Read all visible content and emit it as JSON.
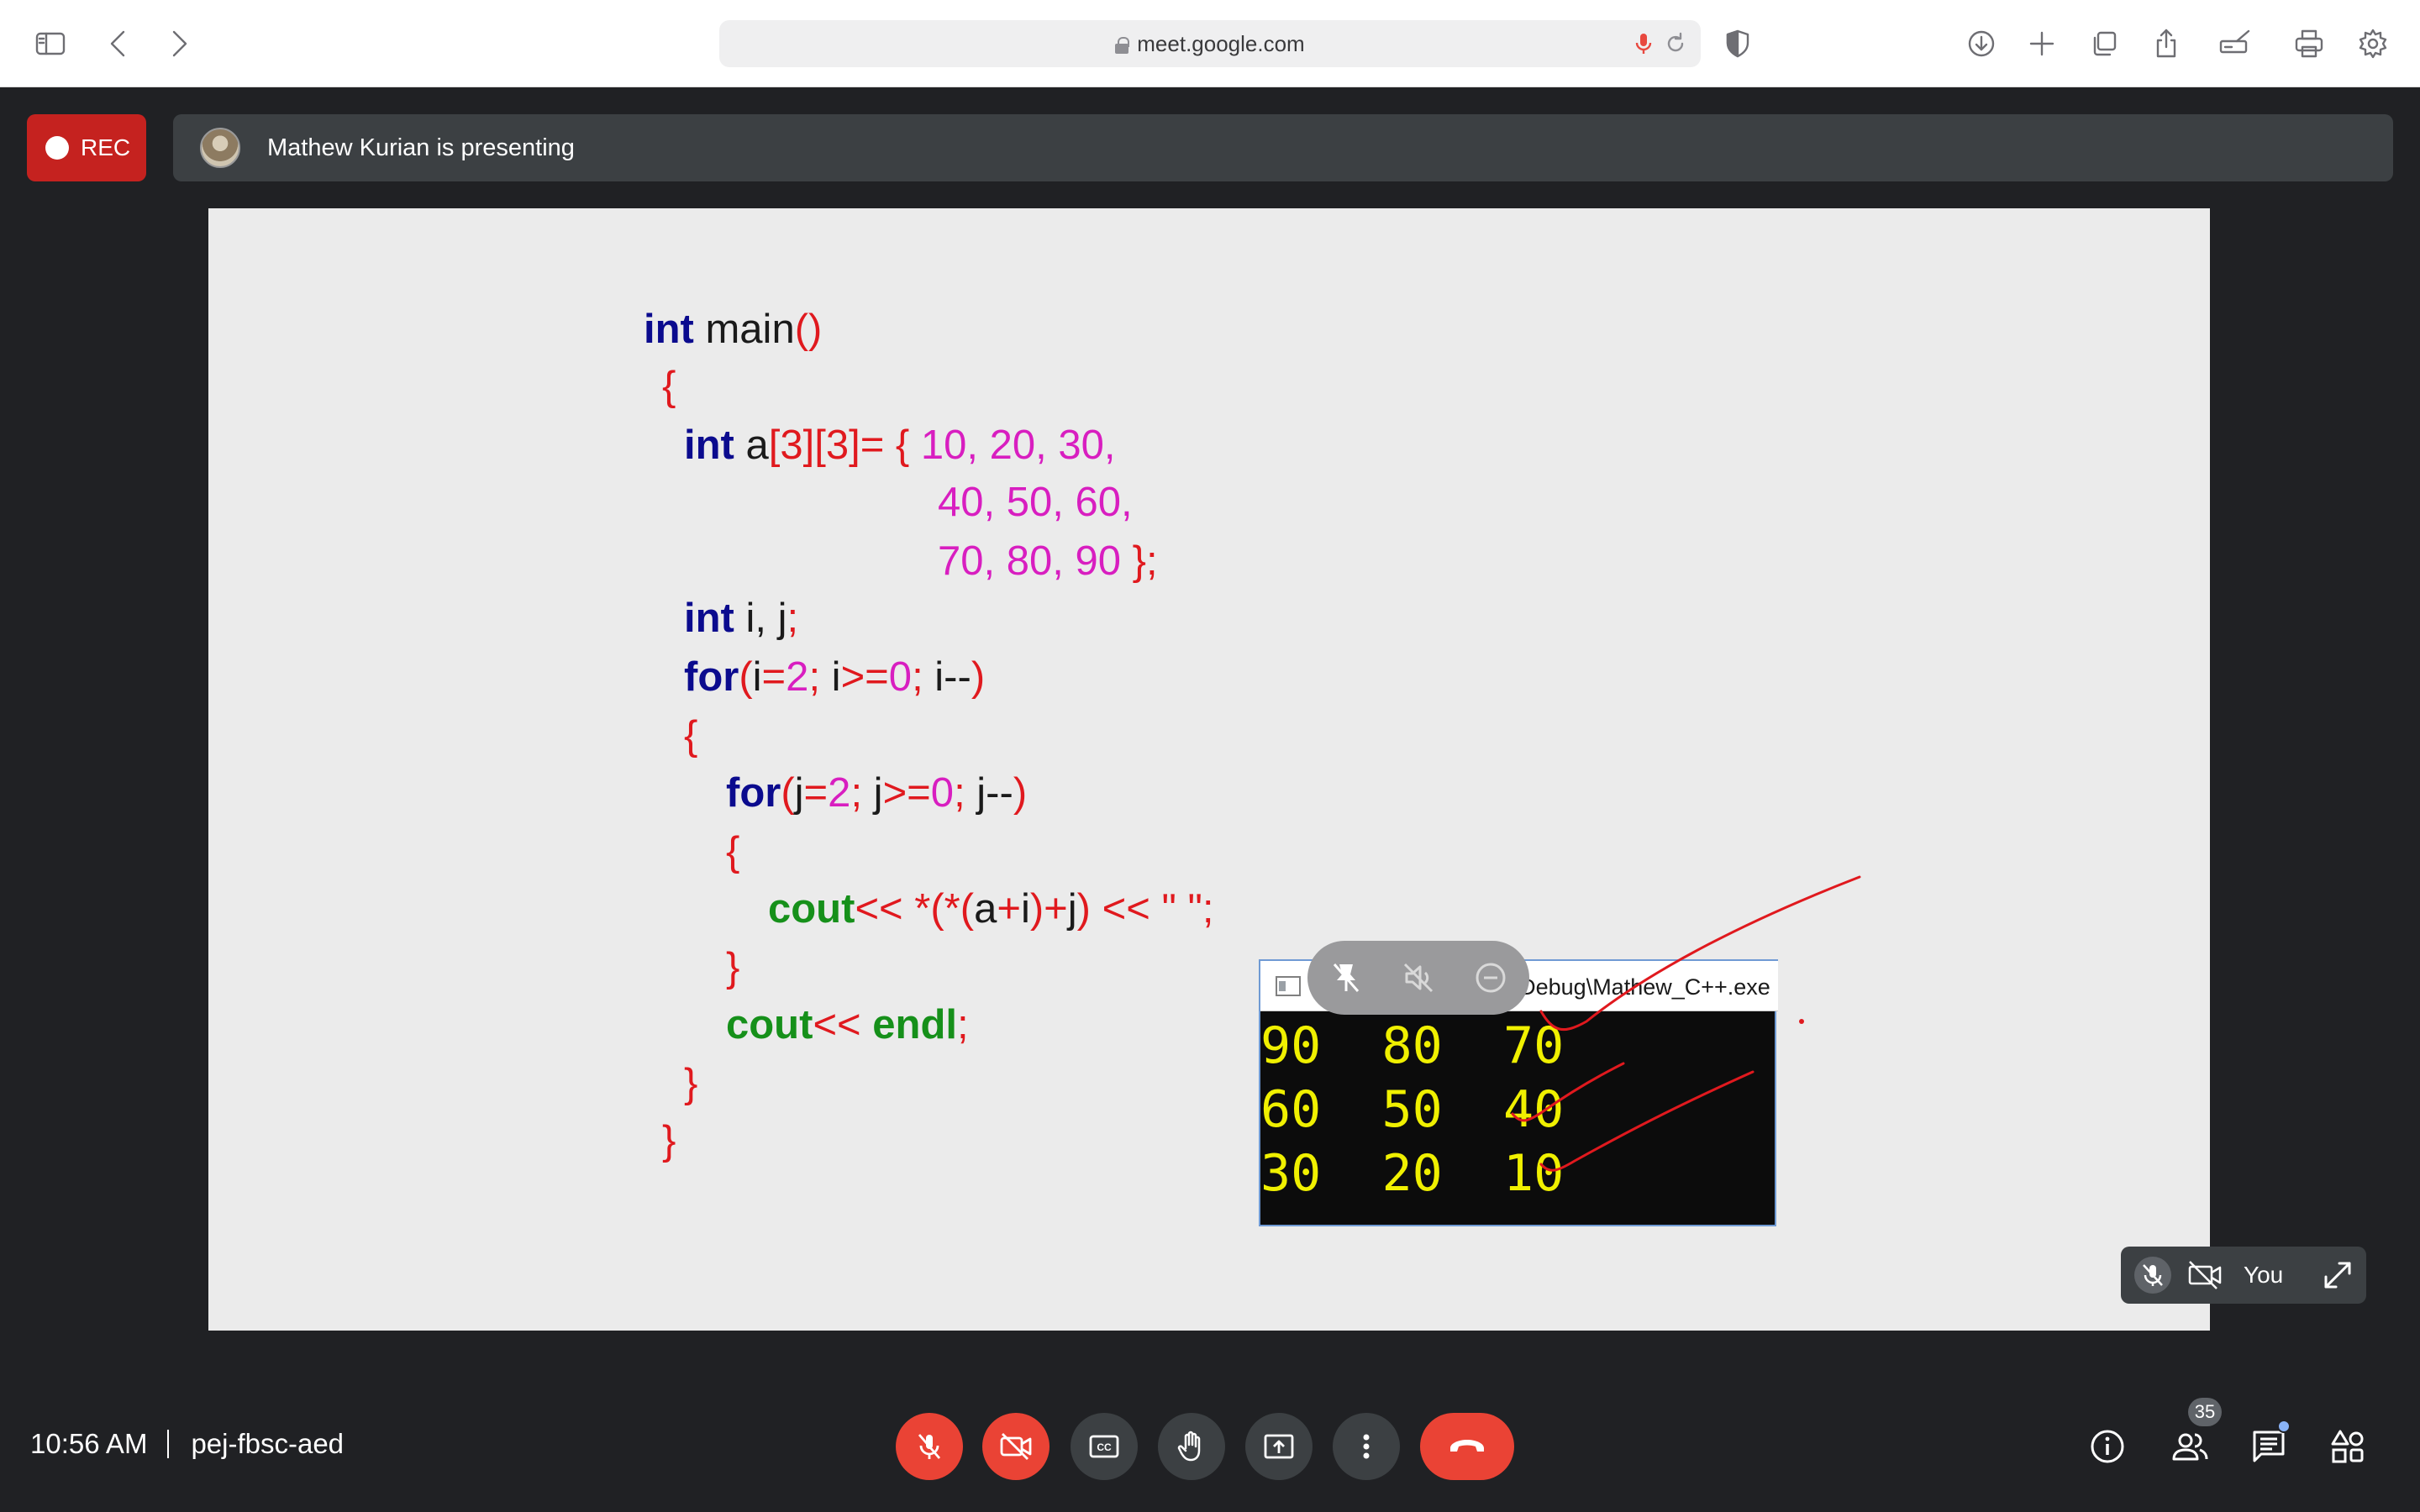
{
  "browser": {
    "url": "meet.google.com"
  },
  "meet": {
    "rec_label": "REC",
    "presenter_text": "Mathew Kurian is presenting",
    "time": "10:56 AM",
    "meeting_code": "pej-fbsc-aed",
    "self_label": "You",
    "participants_count": "35"
  },
  "slide": {
    "code_lines": [
      {
        "parts": [
          [
            "int",
            "kw"
          ],
          [
            " main",
            "id"
          ],
          [
            "()",
            "pu"
          ]
        ]
      },
      {
        "parts": [
          [
            "{",
            "pu"
          ]
        ]
      },
      {
        "parts": [
          [
            "int",
            "kw"
          ],
          [
            " a",
            "id"
          ],
          [
            "[3][3]= {",
            "pu"
          ],
          [
            " 10, 20, 30,",
            "nm"
          ]
        ]
      },
      {
        "parts": [
          [
            "40, 50, 60,",
            "nm"
          ]
        ]
      },
      {
        "parts": [
          [
            "70, 80, 90",
            "nm"
          ],
          [
            " };",
            "pu"
          ]
        ]
      },
      {
        "parts": [
          [
            "int",
            "kw"
          ],
          [
            " i, j",
            "id"
          ],
          [
            ";",
            "pu"
          ]
        ]
      },
      {
        "parts": [
          [
            "for",
            "kw"
          ],
          [
            "(",
            "pu"
          ],
          [
            "i",
            "id"
          ],
          [
            "=",
            "pu"
          ],
          [
            "2",
            "nm"
          ],
          [
            "; ",
            "pu"
          ],
          [
            "i",
            "id"
          ],
          [
            ">=",
            "pu"
          ],
          [
            "0",
            "nm"
          ],
          [
            "; ",
            "pu"
          ],
          [
            "i--",
            "id"
          ],
          [
            ")",
            "pu"
          ]
        ]
      },
      {
        "parts": [
          [
            "{",
            "pu"
          ]
        ]
      },
      {
        "parts": [
          [
            "for",
            "kw"
          ],
          [
            "(",
            "pu"
          ],
          [
            "j",
            "id"
          ],
          [
            "=",
            "pu"
          ],
          [
            "2",
            "nm"
          ],
          [
            "; ",
            "pu"
          ],
          [
            "j",
            "id"
          ],
          [
            ">=",
            "pu"
          ],
          [
            "0",
            "nm"
          ],
          [
            "; ",
            "pu"
          ],
          [
            "j--",
            "id"
          ],
          [
            ")",
            "pu"
          ]
        ]
      },
      {
        "parts": [
          [
            "{",
            "pu"
          ]
        ]
      },
      {
        "parts": [
          [
            "cout",
            "gr"
          ],
          [
            "<< *(*(",
            "pu"
          ],
          [
            "a",
            "id"
          ],
          [
            "+",
            "pu"
          ],
          [
            "i",
            "id"
          ],
          [
            ")+",
            "pu"
          ],
          [
            "j",
            "id"
          ],
          [
            ")",
            "pu"
          ],
          [
            " << \" \";",
            "pu"
          ]
        ]
      },
      {
        "parts": [
          [
            "}",
            "pu"
          ]
        ]
      },
      {
        "parts": [
          [
            "cout",
            "gr"
          ],
          [
            "<<",
            "pu"
          ],
          [
            " endl",
            "gr"
          ],
          [
            ";",
            "pu"
          ]
        ]
      },
      {
        "parts": [
          [
            "}",
            "pu"
          ]
        ]
      },
      {
        "parts": [
          [
            "}",
            "pu"
          ]
        ]
      }
    ],
    "console_title": "C:\\Mathew_C++\\bin\\Debug\\Mathew_C++.exe",
    "console_lines": [
      "90  80  70",
      "60  50  40",
      "30  20  10"
    ]
  },
  "colors": {
    "meet_bg": "#202124",
    "rec_red": "#c5221f",
    "end_call_red": "#ea4335",
    "keyword_blue": "#0b0b8e",
    "number_magenta": "#d81ec0",
    "cout_green": "#16901a",
    "console_yellow": "#f0f000"
  },
  "icons": {
    "toolbar": [
      "sidebar-icon",
      "back-icon",
      "forward-icon",
      "shield-icon",
      "download-icon",
      "new-tab-icon",
      "tab-overview-icon",
      "share-icon",
      "markup-icon",
      "print-icon",
      "settings-icon"
    ],
    "controls": [
      "mic-off-icon",
      "camera-off-icon",
      "captions-icon",
      "raise-hand-icon",
      "present-icon",
      "more-options-icon",
      "end-call-icon"
    ],
    "right": [
      "info-icon",
      "people-icon",
      "chat-icon",
      "activities-icon"
    ]
  }
}
